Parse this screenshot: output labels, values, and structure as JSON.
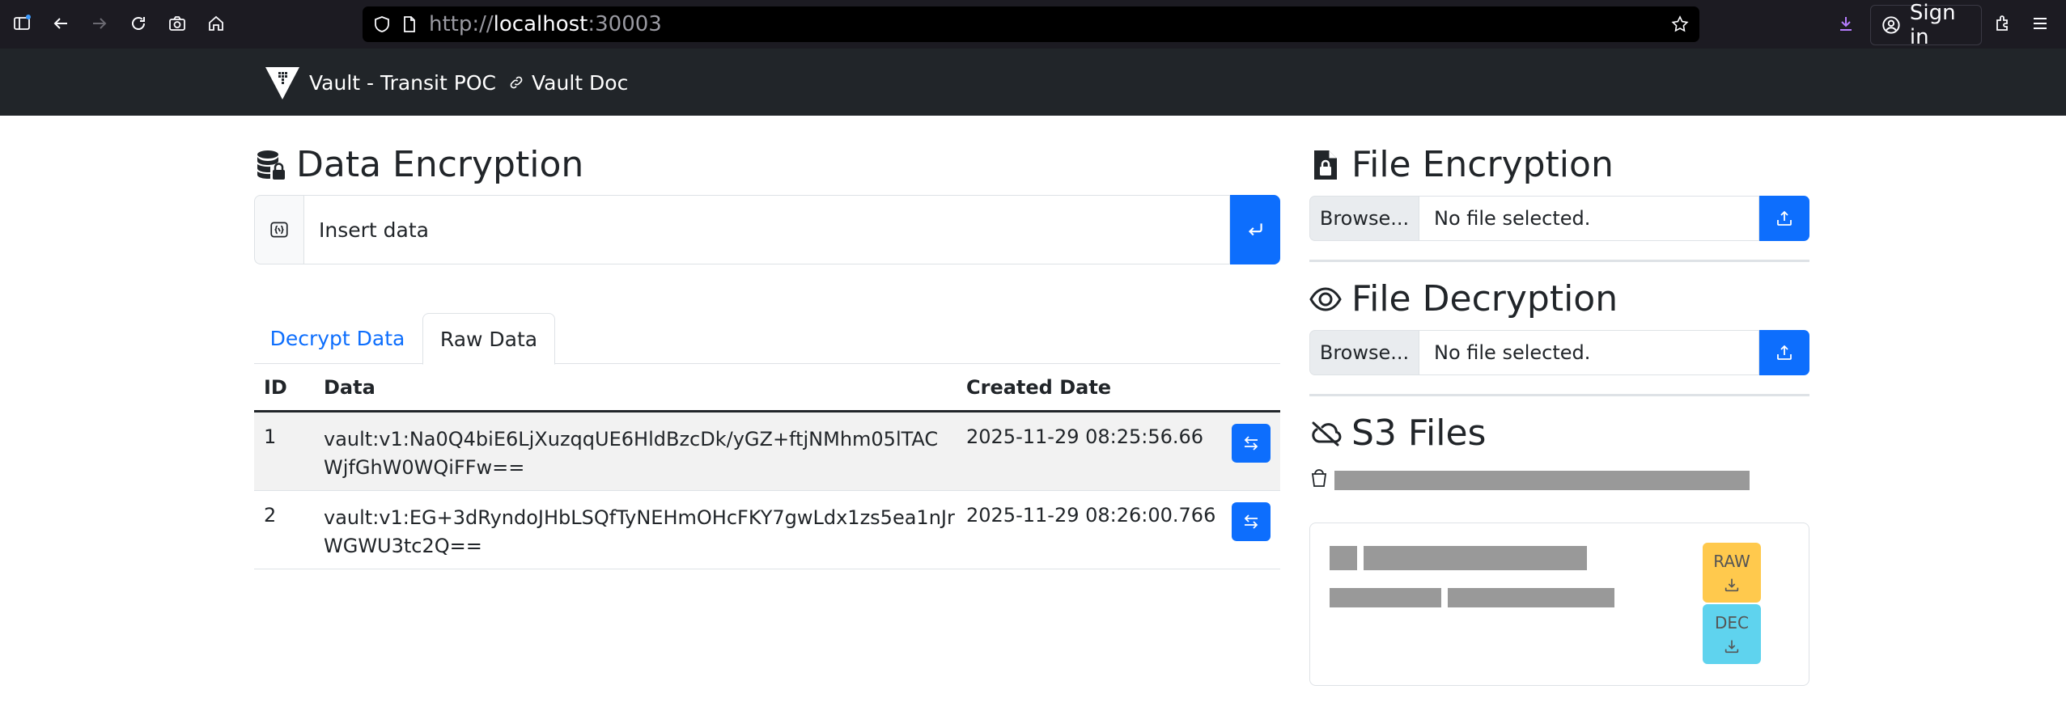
{
  "browser": {
    "url_prefix": "http://",
    "url_host": "localhost",
    "url_port": ":30003",
    "sign_in_label": "Sign in"
  },
  "navbar": {
    "brand": "Vault - Transit POC",
    "doc_link": "Vault Doc"
  },
  "data_encryption": {
    "title": "Data Encryption",
    "input_placeholder": "Insert data",
    "tabs": [
      {
        "label": "Decrypt Data",
        "active": false
      },
      {
        "label": "Raw Data",
        "active": true
      }
    ],
    "table": {
      "headers": [
        "ID",
        "Data",
        "Created Date"
      ],
      "rows": [
        {
          "id": "1",
          "data": "vault:v1:Na0Q4biE6LjXuzqqUE6HldBzcDk/yGZ+ftjNMhm05lTACWjfGhW0WQiFFw==",
          "created": "2025-11-29 08:25:56.66"
        },
        {
          "id": "2",
          "data": "vault:v1:EG+3dRyndoJHbLSQfTyNEHmOHcFKY7gwLdx1zs5ea1nJrWGWU3tc2Q==",
          "created": "2025-11-29 08:26:00.766"
        }
      ]
    }
  },
  "file_encryption": {
    "title": "File Encryption",
    "browse_label": "Browse...",
    "file_label": "No file selected."
  },
  "file_decryption": {
    "title": "File Decryption",
    "browse_label": "Browse...",
    "file_label": "No file selected."
  },
  "s3_files": {
    "title": "S3 Files",
    "raw_label": "RAW",
    "dec_label": "DEC"
  },
  "colors": {
    "primary": "#0d6efd",
    "navbar": "#212529",
    "warning": "#ffc94d",
    "info": "#5fd3ee"
  }
}
